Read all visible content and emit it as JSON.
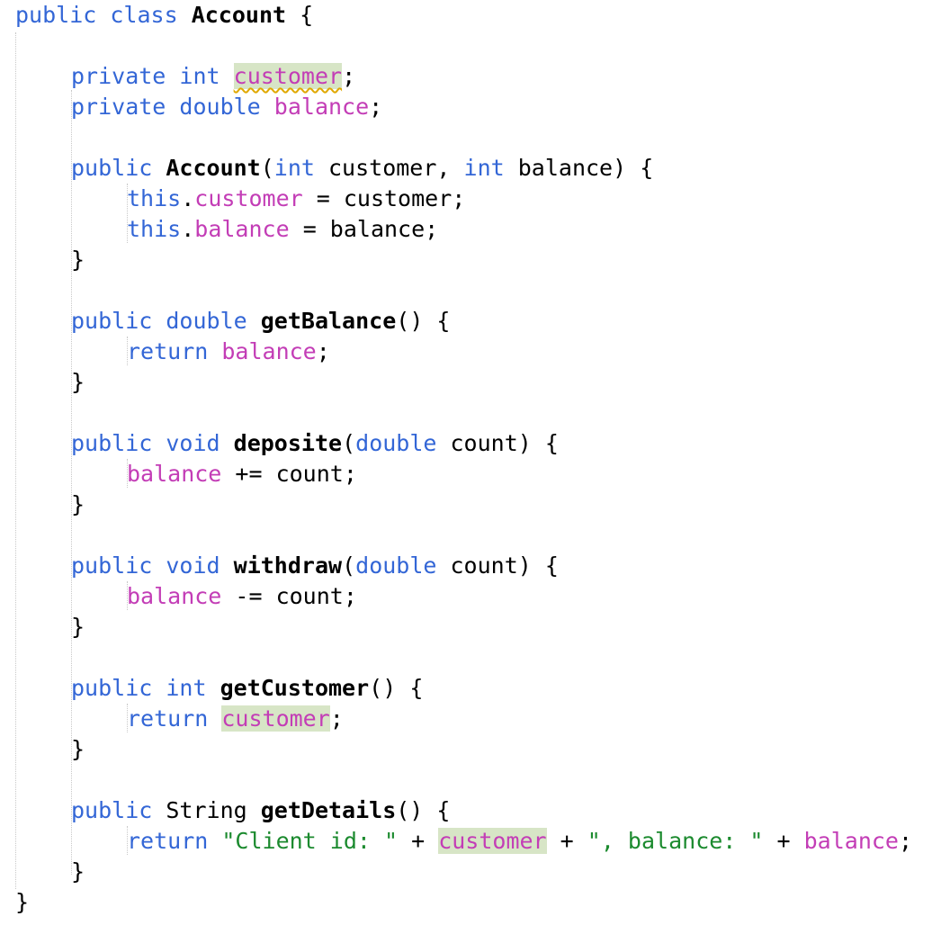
{
  "editor": {
    "language": "java",
    "colors": {
      "keyword": "#3366d6",
      "field": "#c33db6",
      "string": "#1b8a2e",
      "text": "#000000",
      "highlight": "#d7e5c6",
      "warning_squiggle": "#e0a800",
      "indent_guide": "#c8c8c8",
      "background": "#ffffff"
    },
    "lines": [
      {
        "indent": 0,
        "tokens": [
          {
            "t": "public",
            "c": "kw"
          },
          {
            "t": " ",
            "c": "plain"
          },
          {
            "t": "class",
            "c": "kw"
          },
          {
            "t": " ",
            "c": "plain"
          },
          {
            "t": "Account",
            "c": "bold"
          },
          {
            "t": " {",
            "c": "plain"
          }
        ]
      },
      {
        "indent": 0,
        "tokens": []
      },
      {
        "indent": 1,
        "tokens": [
          {
            "t": "private",
            "c": "kw"
          },
          {
            "t": " ",
            "c": "plain"
          },
          {
            "t": "int",
            "c": "kw"
          },
          {
            "t": " ",
            "c": "plain"
          },
          {
            "t": "customer",
            "c": "fld",
            "hl": true,
            "squiggle": true
          },
          {
            "t": ";",
            "c": "plain"
          }
        ]
      },
      {
        "indent": 1,
        "tokens": [
          {
            "t": "private",
            "c": "kw"
          },
          {
            "t": " ",
            "c": "plain"
          },
          {
            "t": "double",
            "c": "kw"
          },
          {
            "t": " ",
            "c": "plain"
          },
          {
            "t": "balance",
            "c": "fld"
          },
          {
            "t": ";",
            "c": "plain"
          }
        ]
      },
      {
        "indent": 0,
        "tokens": []
      },
      {
        "indent": 1,
        "tokens": [
          {
            "t": "public",
            "c": "kw"
          },
          {
            "t": " ",
            "c": "plain"
          },
          {
            "t": "Account",
            "c": "bold"
          },
          {
            "t": "(",
            "c": "plain"
          },
          {
            "t": "int",
            "c": "kw"
          },
          {
            "t": " customer, ",
            "c": "plain"
          },
          {
            "t": "int",
            "c": "kw"
          },
          {
            "t": " balance) {",
            "c": "plain"
          }
        ]
      },
      {
        "indent": 2,
        "tokens": [
          {
            "t": "this",
            "c": "kw"
          },
          {
            "t": ".",
            "c": "plain"
          },
          {
            "t": "customer",
            "c": "fld"
          },
          {
            "t": " = customer;",
            "c": "plain"
          }
        ]
      },
      {
        "indent": 2,
        "tokens": [
          {
            "t": "this",
            "c": "kw"
          },
          {
            "t": ".",
            "c": "plain"
          },
          {
            "t": "balance",
            "c": "fld"
          },
          {
            "t": " = balance;",
            "c": "plain"
          }
        ]
      },
      {
        "indent": 1,
        "tokens": [
          {
            "t": "}",
            "c": "plain"
          }
        ]
      },
      {
        "indent": 0,
        "tokens": []
      },
      {
        "indent": 1,
        "tokens": [
          {
            "t": "public",
            "c": "kw"
          },
          {
            "t": " ",
            "c": "plain"
          },
          {
            "t": "double",
            "c": "kw"
          },
          {
            "t": " ",
            "c": "plain"
          },
          {
            "t": "getBalance",
            "c": "fn"
          },
          {
            "t": "() {",
            "c": "plain"
          }
        ]
      },
      {
        "indent": 2,
        "tokens": [
          {
            "t": "return",
            "c": "kw"
          },
          {
            "t": " ",
            "c": "plain"
          },
          {
            "t": "balance",
            "c": "fld"
          },
          {
            "t": ";",
            "c": "plain"
          }
        ]
      },
      {
        "indent": 1,
        "tokens": [
          {
            "t": "}",
            "c": "plain"
          }
        ]
      },
      {
        "indent": 0,
        "tokens": []
      },
      {
        "indent": 1,
        "tokens": [
          {
            "t": "public",
            "c": "kw"
          },
          {
            "t": " ",
            "c": "plain"
          },
          {
            "t": "void",
            "c": "kw"
          },
          {
            "t": " ",
            "c": "plain"
          },
          {
            "t": "deposite",
            "c": "fn"
          },
          {
            "t": "(",
            "c": "plain"
          },
          {
            "t": "double",
            "c": "kw"
          },
          {
            "t": " count) {",
            "c": "plain"
          }
        ]
      },
      {
        "indent": 2,
        "tokens": [
          {
            "t": "balance",
            "c": "fld"
          },
          {
            "t": " += count;",
            "c": "plain"
          }
        ]
      },
      {
        "indent": 1,
        "tokens": [
          {
            "t": "}",
            "c": "plain"
          }
        ]
      },
      {
        "indent": 0,
        "tokens": []
      },
      {
        "indent": 1,
        "tokens": [
          {
            "t": "public",
            "c": "kw"
          },
          {
            "t": " ",
            "c": "plain"
          },
          {
            "t": "void",
            "c": "kw"
          },
          {
            "t": " ",
            "c": "plain"
          },
          {
            "t": "withdraw",
            "c": "fn"
          },
          {
            "t": "(",
            "c": "plain"
          },
          {
            "t": "double",
            "c": "kw"
          },
          {
            "t": " count) {",
            "c": "plain"
          }
        ]
      },
      {
        "indent": 2,
        "tokens": [
          {
            "t": "balance",
            "c": "fld"
          },
          {
            "t": " -= count;",
            "c": "plain"
          }
        ]
      },
      {
        "indent": 1,
        "tokens": [
          {
            "t": "}",
            "c": "plain"
          }
        ]
      },
      {
        "indent": 0,
        "tokens": []
      },
      {
        "indent": 1,
        "tokens": [
          {
            "t": "public",
            "c": "kw"
          },
          {
            "t": " ",
            "c": "plain"
          },
          {
            "t": "int",
            "c": "kw"
          },
          {
            "t": " ",
            "c": "plain"
          },
          {
            "t": "getCustomer",
            "c": "fn"
          },
          {
            "t": "() {",
            "c": "plain"
          }
        ]
      },
      {
        "indent": 2,
        "tokens": [
          {
            "t": "return",
            "c": "kw"
          },
          {
            "t": " ",
            "c": "plain"
          },
          {
            "t": "customer",
            "c": "fld",
            "hl": true
          },
          {
            "t": ";",
            "c": "plain"
          }
        ]
      },
      {
        "indent": 1,
        "tokens": [
          {
            "t": "}",
            "c": "plain"
          }
        ]
      },
      {
        "indent": 0,
        "tokens": []
      },
      {
        "indent": 1,
        "tokens": [
          {
            "t": "public",
            "c": "kw"
          },
          {
            "t": " String ",
            "c": "plain"
          },
          {
            "t": "getDetails",
            "c": "fn"
          },
          {
            "t": "() {",
            "c": "plain"
          }
        ]
      },
      {
        "indent": 2,
        "tokens": [
          {
            "t": "return",
            "c": "kw"
          },
          {
            "t": " ",
            "c": "plain"
          },
          {
            "t": "\"Client id: \"",
            "c": "str"
          },
          {
            "t": " + ",
            "c": "plain"
          },
          {
            "t": "customer",
            "c": "fld",
            "hl": true
          },
          {
            "t": " + ",
            "c": "plain"
          },
          {
            "t": "\", balance: \"",
            "c": "str"
          },
          {
            "t": " + ",
            "c": "plain"
          },
          {
            "t": "balance",
            "c": "fld"
          },
          {
            "t": ";",
            "c": "plain"
          }
        ]
      },
      {
        "indent": 1,
        "tokens": [
          {
            "t": "}",
            "c": "plain"
          }
        ]
      },
      {
        "indent": 0,
        "tokens": [
          {
            "t": "}",
            "c": "plain"
          }
        ]
      }
    ]
  }
}
